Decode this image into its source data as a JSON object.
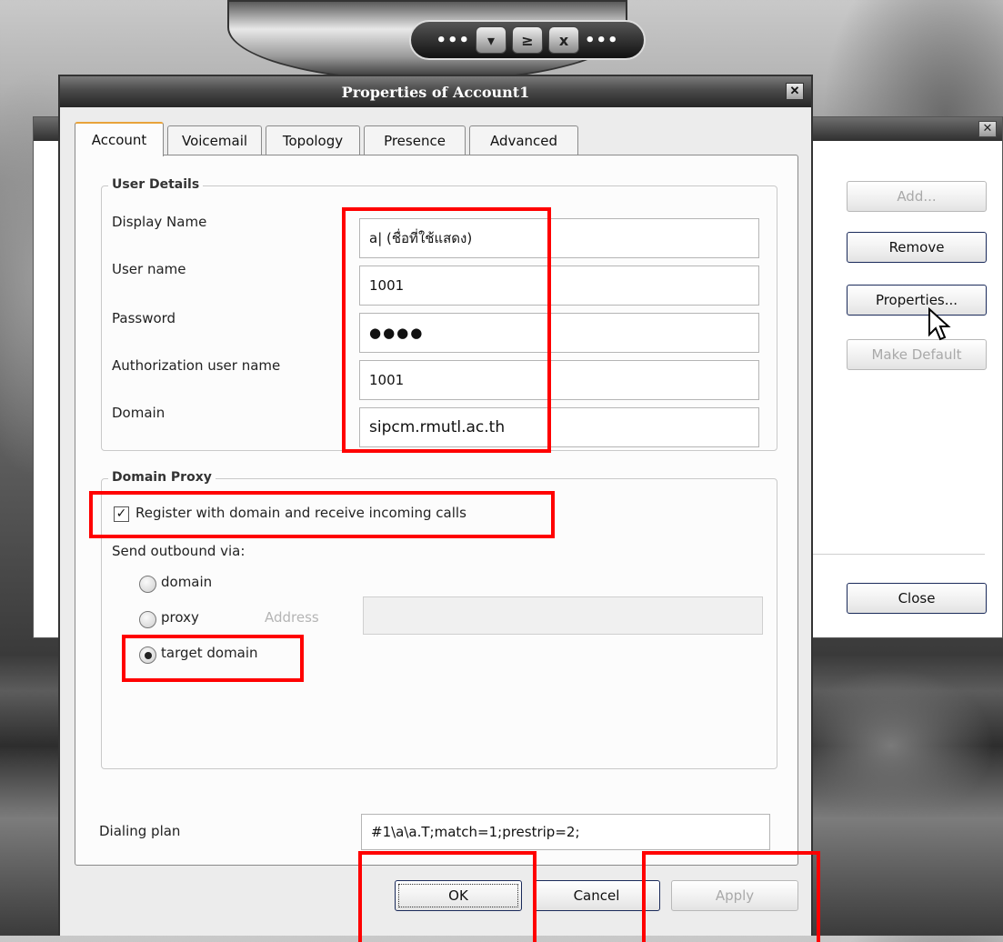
{
  "phone_toolbar": {
    "left_dots": "•••",
    "right_dots": "•••",
    "buttons": [
      {
        "icon": "chevron-down-icon",
        "glyph": "▾"
      },
      {
        "icon": "minimize-icon",
        "glyph": "≥"
      },
      {
        "icon": "close-icon",
        "glyph": "x"
      }
    ]
  },
  "accounts_window": {
    "close_glyph": "✕",
    "buttons": {
      "add": "Add...",
      "remove": "Remove",
      "properties": "Properties...",
      "make_default": "Make Default",
      "close": "Close"
    }
  },
  "dialog": {
    "title": "Properties of Account1",
    "close_glyph": "✕",
    "tabs": [
      "Account",
      "Voicemail",
      "Topology",
      "Presence",
      "Advanced"
    ],
    "active_tab": "Account",
    "user_details": {
      "title": "User Details",
      "fields": [
        {
          "label": "Display Name",
          "value": "a| (ชื่อที่ใช้แสดง)"
        },
        {
          "label": "User name",
          "value": "1001"
        },
        {
          "label": "Password",
          "value": "●●●●"
        },
        {
          "label": "Authorization user name",
          "value": "1001"
        },
        {
          "label": "Domain",
          "value": "sipcm.rmutl.ac.th"
        }
      ]
    },
    "domain_proxy": {
      "title": "Domain Proxy",
      "register_label": "Register with domain and receive incoming calls",
      "register_checked": true,
      "send_outbound_label": "Send outbound via:",
      "options": [
        "domain",
        "proxy",
        "target domain"
      ],
      "selected_option": "target domain",
      "address_label": "Address",
      "address_value": ""
    },
    "dialing_plan": {
      "label": "Dialing plan",
      "value": "#1\\a\\a.T;match=1;prestrip=2;"
    },
    "buttons": {
      "ok": "OK",
      "cancel": "Cancel",
      "apply": "Apply"
    }
  },
  "colors": {
    "highlight": "#ff0000",
    "titlebar": "#2f2f2f",
    "active_tab_accent": "#e8a33a"
  }
}
